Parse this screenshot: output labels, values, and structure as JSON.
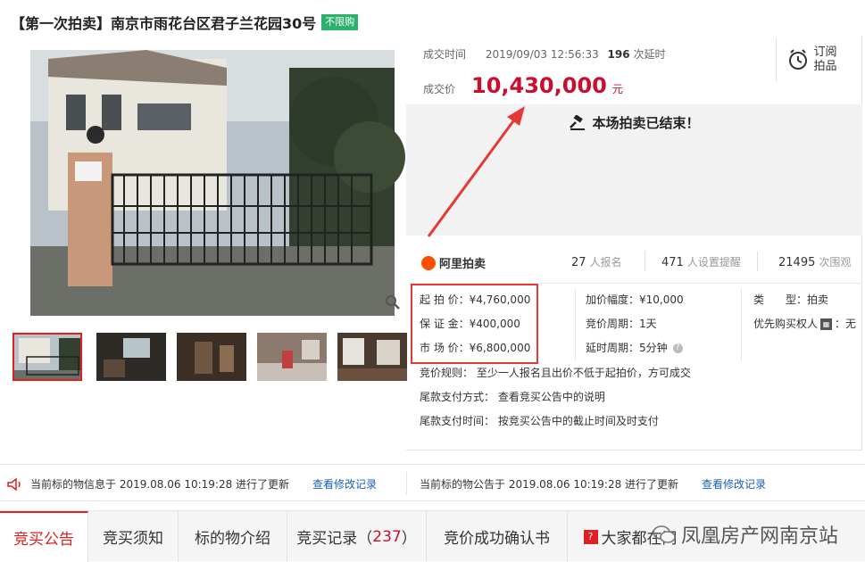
{
  "title": {
    "text": "【第一次拍卖】南京市雨花台区君子兰花园30号",
    "badge": "不限购"
  },
  "deal": {
    "time_label": "成交时间",
    "time_value": "2019/09/03 12:56:33",
    "delay_count": "196",
    "delay_suffix": "次延时",
    "price_label": "成交价",
    "price_value": "10,430,000",
    "price_unit": "元"
  },
  "subscribe": {
    "line1": "订阅",
    "line2": "拍品"
  },
  "status": {
    "ended_text": "本场拍卖已结束！"
  },
  "stats": {
    "logo_text": "阿里拍卖",
    "signup_count": "27",
    "signup_label": "人报名",
    "reminder_count": "471",
    "reminder_label": "人设置提醒",
    "view_count": "21495",
    "view_label": "次围观"
  },
  "params": {
    "start_price": "起 拍 价：¥4,760,000",
    "deposit": "保 证 金：¥400,000",
    "market_price": "市 场 价：¥6,800,000",
    "increment": "加价幅度：¥10,000",
    "cycle": "竞价周期：1天",
    "extension": "延时周期：5分钟",
    "type_label": "类　　型：",
    "type_value": "拍卖",
    "priority_label": "优先购买权人",
    "priority_value": "：无",
    "rule": "竞价规则：  至少一人报名且出价不低于起拍价，方可成交",
    "payment_method": "尾款支付方式：  查看竞买公告中的说明",
    "payment_time": "尾款支付时间：  按竞买公告中的截止时间及时支付"
  },
  "updates": {
    "left_text": "当前标的物信息于 2019.08.06 10:19:28 进行了更新",
    "left_link": "查看修改记录",
    "right_text": "当前标的物公告于 2019.08.06 10:19:28 进行了更新",
    "right_link": "查看修改记录"
  },
  "tabs": {
    "notice": "竞买公告",
    "instructions": "竞买须知",
    "intro": "标的物介绍",
    "records_label": "竞买记录",
    "records_open": "（",
    "records_count": "237",
    "records_close": "）",
    "confirmation": "竞价成功确认书",
    "qa": "大家都在问"
  },
  "watermark": "凤凰房产网南京站",
  "colors": {
    "price_red": "#c8102e",
    "badge_green": "#2db06b",
    "accent_red": "#e02020",
    "link_blue": "#1a5fb4"
  }
}
